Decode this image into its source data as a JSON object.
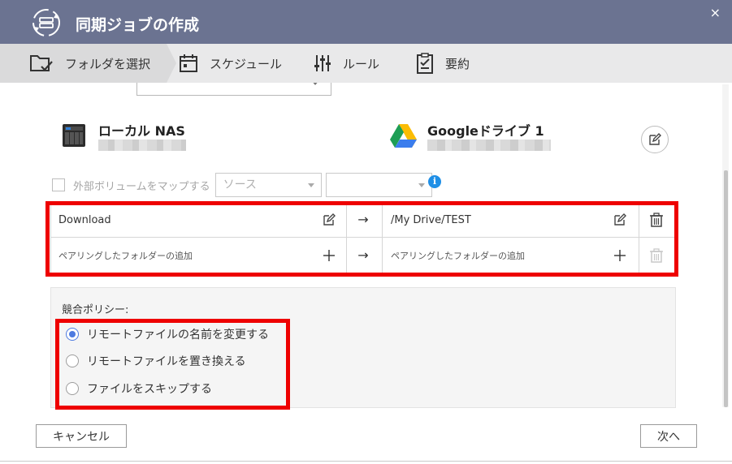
{
  "window": {
    "title": "同期ジョブの作成"
  },
  "steps": [
    {
      "label": "フォルダを選択",
      "active": true
    },
    {
      "label": "スケジュール"
    },
    {
      "label": "ルール"
    },
    {
      "label": "要約"
    }
  ],
  "source": {
    "name": "ローカル NAS"
  },
  "destination": {
    "name": "Googleドライブ 1"
  },
  "map_volume": {
    "label": "外部ボリュームをマップする",
    "source_placeholder": "ソース",
    "second_select": ""
  },
  "pairs": [
    {
      "local": "Download",
      "remote": "/My Drive/TEST"
    },
    {
      "local": "ペアリングしたフォルダーの追加",
      "remote": "ペアリングしたフォルダーの追加"
    }
  ],
  "arrow": "→",
  "policy": {
    "label": "競合ポリシー:",
    "options": [
      {
        "label": "リモートファイルの名前を変更する",
        "selected": true
      },
      {
        "label": "リモートファイルを置き換える",
        "selected": false
      },
      {
        "label": "ファイルをスキップする",
        "selected": false
      }
    ]
  },
  "buttons": {
    "cancel": "キャンセル",
    "next": "次へ"
  },
  "colors": {
    "titlebar": "#6b7391",
    "highlight": "#ee0000",
    "accent": "#4e7be0",
    "info": "#1f8fe6"
  },
  "icons": {
    "close": "×",
    "info": "i"
  }
}
